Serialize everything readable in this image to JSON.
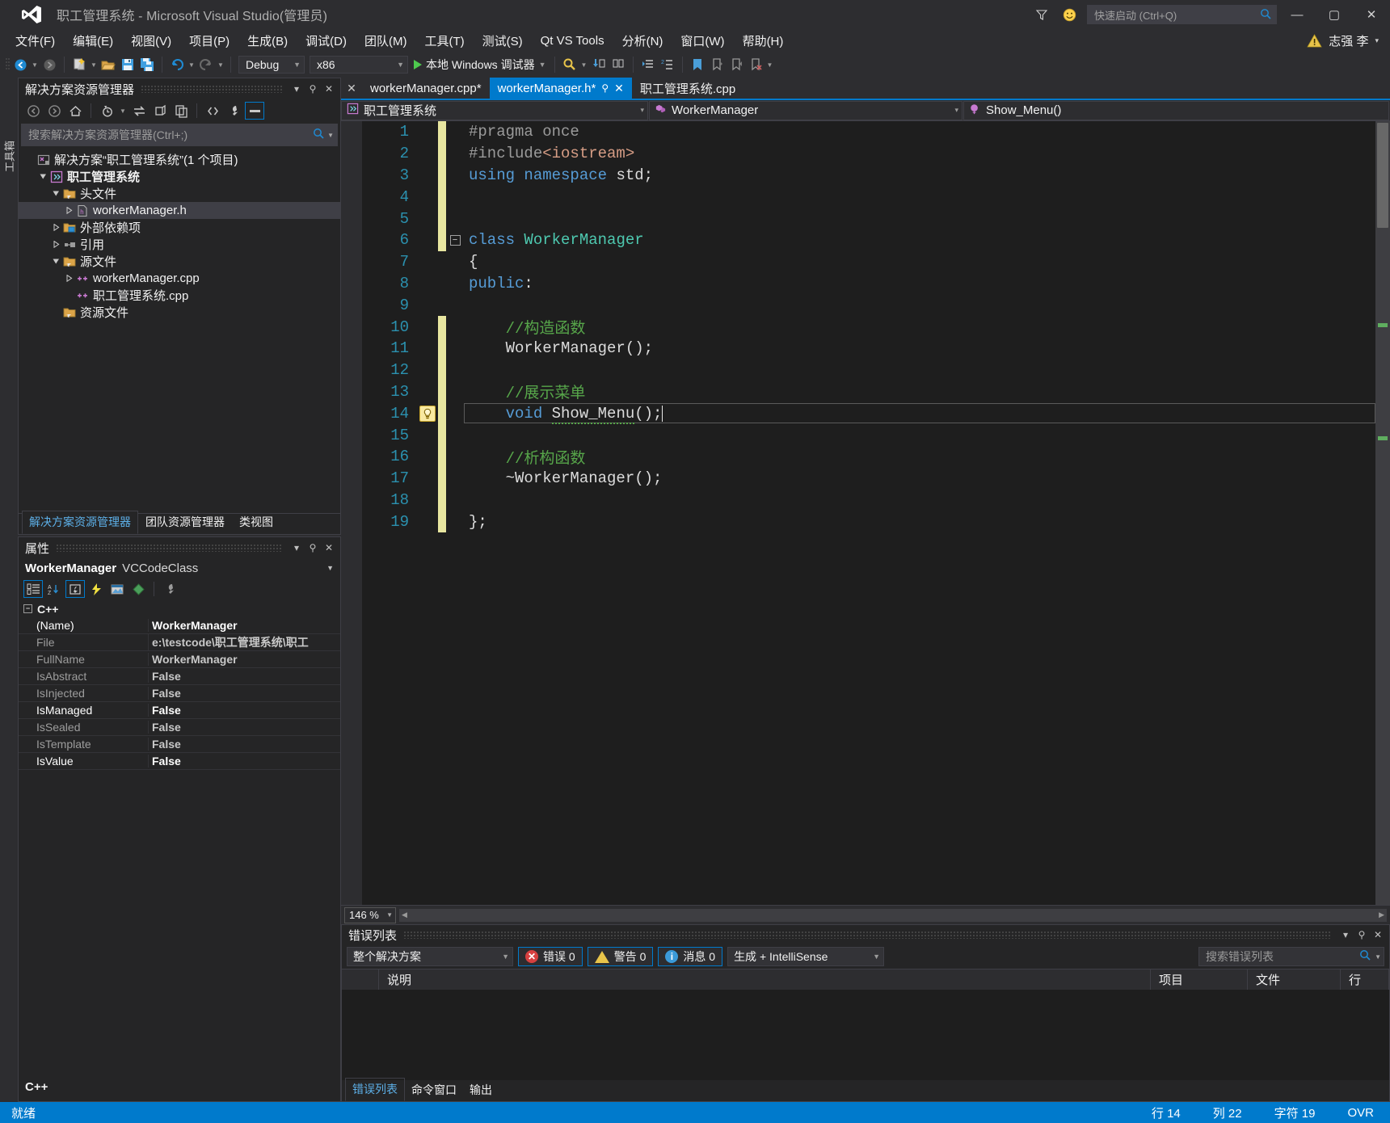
{
  "titlebar": {
    "title": "职工管理系统 - Microsoft Visual Studio(管理员)",
    "quick_launch_placeholder": "快速启动 (Ctrl+Q)",
    "minimize": "—",
    "maximize": "▢",
    "close": "✕",
    "feedback_icon": "smiley-icon",
    "filter_icon": "funnel-icon"
  },
  "menubar": {
    "items": [
      "文件(F)",
      "编辑(E)",
      "视图(V)",
      "项目(P)",
      "生成(B)",
      "调试(D)",
      "团队(M)",
      "工具(T)",
      "测试(S)",
      "Qt VS Tools",
      "分析(N)",
      "窗口(W)",
      "帮助(H)"
    ],
    "user": "志强 李",
    "user_caret": "▾"
  },
  "toolbar": {
    "nav_back": "◀",
    "nav_forward": "▶",
    "config": "Debug",
    "platform": "x86",
    "run_label": "本地 Windows 调试器",
    "caret": "▾"
  },
  "left_vertical_tab": "工具箱",
  "solution_explorer": {
    "title": "解决方案资源管理器",
    "pin": "⚲",
    "close": "✕",
    "caret": "▾",
    "search_placeholder": "搜索解决方案资源管理器(Ctrl+;)",
    "toolbar_icons": [
      "back-icon",
      "forward-icon",
      "home-icon",
      "pending-changes-icon",
      "sync-with-active-document-icon",
      "refresh-icon",
      "collapse-all-icon",
      "show-all-files-icon",
      "properties-icon",
      "preview-selected-items-icon"
    ],
    "tree": [
      {
        "label": "解决方案“职工管理系统”(1 个项目)",
        "indent": 0,
        "arrow": "none",
        "icon": "solution-icon",
        "selected": false,
        "bold": false
      },
      {
        "label": "职工管理系统",
        "indent": 1,
        "arrow": "open",
        "icon": "cpp-project-icon",
        "selected": false,
        "bold": true
      },
      {
        "label": "头文件",
        "indent": 2,
        "arrow": "open",
        "icon": "folder-filter-icon",
        "selected": false,
        "bold": false
      },
      {
        "label": "workerManager.h",
        "indent": 3,
        "arrow": "closed",
        "icon": "h-file-icon",
        "selected": true,
        "bold": false
      },
      {
        "label": "外部依赖项",
        "indent": 2,
        "arrow": "closed",
        "icon": "external-deps-icon",
        "selected": false,
        "bold": false
      },
      {
        "label": "引用",
        "indent": 2,
        "arrow": "closed",
        "icon": "references-icon",
        "selected": false,
        "bold": false
      },
      {
        "label": "源文件",
        "indent": 2,
        "arrow": "open",
        "icon": "folder-filter-icon",
        "selected": false,
        "bold": false
      },
      {
        "label": "workerManager.cpp",
        "indent": 3,
        "arrow": "closed",
        "icon": "cpp-file-icon",
        "selected": false,
        "bold": false
      },
      {
        "label": "职工管理系统.cpp",
        "indent": 3,
        "arrow": "none",
        "icon": "cpp-file-icon",
        "selected": false,
        "bold": false
      },
      {
        "label": "资源文件",
        "indent": 2,
        "arrow": "none",
        "icon": "folder-filter-icon",
        "selected": false,
        "bold": false
      }
    ],
    "tabs": [
      {
        "label": "解决方案资源管理器",
        "active": true
      },
      {
        "label": "团队资源管理器",
        "active": false
      },
      {
        "label": "类视图",
        "active": false
      }
    ]
  },
  "properties": {
    "title": "属性",
    "caret": "▾",
    "pin": "⚲",
    "close": "✕",
    "object_name": "WorkerManager",
    "object_type": "VCCodeClass",
    "toolbar_icons": [
      "categorized-icon",
      "alphabetical-icon",
      "properties-page-icon",
      "events-icon",
      "property-pages-icon",
      "messages-icon",
      "wrench-icon"
    ],
    "category": "C++",
    "rows": [
      {
        "key": "(Name)",
        "value": "WorkerManager",
        "highlight": true
      },
      {
        "key": "File",
        "value": "e:\\testcode\\职工管理系统\\职工",
        "highlight": false
      },
      {
        "key": "FullName",
        "value": "WorkerManager",
        "highlight": false
      },
      {
        "key": "IsAbstract",
        "value": "False",
        "highlight": false
      },
      {
        "key": "IsInjected",
        "value": "False",
        "highlight": false
      },
      {
        "key": "IsManaged",
        "value": "False",
        "highlight": true
      },
      {
        "key": "IsSealed",
        "value": "False",
        "highlight": false
      },
      {
        "key": "IsTemplate",
        "value": "False",
        "highlight": false
      },
      {
        "key": "IsValue",
        "value": "False",
        "highlight": true
      }
    ],
    "footer": "C++"
  },
  "editor": {
    "tabs": [
      {
        "label": "workerManager.cpp*",
        "active": false,
        "pinned": false,
        "closable": false
      },
      {
        "label": "workerManager.h*",
        "active": true,
        "pinned": true,
        "closable": true
      },
      {
        "label": "职工管理系统.cpp",
        "active": false,
        "pinned": false,
        "closable": false
      }
    ],
    "tab_close_left": "✕",
    "tab_pin_glyph": "⚲",
    "tab_close_glyph": "✕",
    "nav": {
      "project": "职工管理系统",
      "class": "WorkerManager",
      "member": "Show_Menu()",
      "arrow": "▾"
    },
    "zoom": "146 %",
    "lines": [
      {
        "n": 1,
        "changed": true,
        "fold": "none",
        "bulb": false,
        "current": false,
        "tokens": [
          {
            "t": "#pragma once",
            "c": "c-pre"
          }
        ]
      },
      {
        "n": 2,
        "changed": true,
        "fold": "none",
        "bulb": false,
        "current": false,
        "tokens": [
          {
            "t": "#include",
            "c": "c-pre"
          },
          {
            "t": "<iostream>",
            "c": "c-str"
          }
        ]
      },
      {
        "n": 3,
        "changed": true,
        "fold": "none",
        "bulb": false,
        "current": false,
        "tokens": [
          {
            "t": "using",
            "c": "c-kw"
          },
          {
            "t": " ",
            "c": "c-punc"
          },
          {
            "t": "namespace",
            "c": "c-kw"
          },
          {
            "t": " std;",
            "c": "c-id"
          }
        ]
      },
      {
        "n": 4,
        "changed": true,
        "fold": "none",
        "bulb": false,
        "current": false,
        "tokens": []
      },
      {
        "n": 5,
        "changed": true,
        "fold": "none",
        "bulb": false,
        "current": false,
        "tokens": []
      },
      {
        "n": 6,
        "changed": true,
        "fold": "start",
        "bulb": false,
        "current": false,
        "tokens": [
          {
            "t": "class",
            "c": "c-kw"
          },
          {
            "t": " ",
            "c": "c-punc"
          },
          {
            "t": "WorkerManager",
            "c": "c-type"
          }
        ]
      },
      {
        "n": 7,
        "changed": false,
        "fold": "line",
        "bulb": false,
        "current": false,
        "tokens": [
          {
            "t": "{",
            "c": "c-punc"
          }
        ]
      },
      {
        "n": 8,
        "changed": false,
        "fold": "line",
        "bulb": false,
        "current": false,
        "tokens": [
          {
            "t": "public",
            "c": "c-kw"
          },
          {
            "t": ":",
            "c": "c-punc"
          }
        ]
      },
      {
        "n": 9,
        "changed": false,
        "fold": "line",
        "bulb": false,
        "current": false,
        "tokens": []
      },
      {
        "n": 10,
        "changed": true,
        "fold": "line",
        "bulb": false,
        "current": false,
        "tokens": [
          {
            "t": "    //构造函数",
            "c": "c-cmt"
          }
        ]
      },
      {
        "n": 11,
        "changed": true,
        "fold": "line",
        "bulb": false,
        "current": false,
        "tokens": [
          {
            "t": "    WorkerManager();",
            "c": "c-id"
          }
        ]
      },
      {
        "n": 12,
        "changed": true,
        "fold": "line",
        "bulb": false,
        "current": false,
        "tokens": []
      },
      {
        "n": 13,
        "changed": true,
        "fold": "line",
        "bulb": false,
        "current": false,
        "tokens": [
          {
            "t": "    //展示菜单",
            "c": "c-cmt"
          }
        ]
      },
      {
        "n": 14,
        "changed": true,
        "fold": "line",
        "bulb": true,
        "current": true,
        "tokens": [
          {
            "t": "    ",
            "c": "c-punc"
          },
          {
            "t": "void",
            "c": "c-kw"
          },
          {
            "t": " ",
            "c": "c-punc"
          },
          {
            "t": "Show_Menu",
            "c": "c-fn",
            "squiggle": true
          },
          {
            "t": "();",
            "c": "c-punc"
          }
        ]
      },
      {
        "n": 15,
        "changed": true,
        "fold": "line",
        "bulb": false,
        "current": false,
        "tokens": []
      },
      {
        "n": 16,
        "changed": true,
        "fold": "line",
        "bulb": false,
        "current": false,
        "tokens": [
          {
            "t": "    //析构函数",
            "c": "c-cmt"
          }
        ]
      },
      {
        "n": 17,
        "changed": true,
        "fold": "line",
        "bulb": false,
        "current": false,
        "tokens": [
          {
            "t": "    ~WorkerManager();",
            "c": "c-id"
          }
        ]
      },
      {
        "n": 18,
        "changed": true,
        "fold": "line",
        "bulb": false,
        "current": false,
        "tokens": []
      },
      {
        "n": 19,
        "changed": true,
        "fold": "end",
        "bulb": false,
        "current": false,
        "tokens": [
          {
            "t": "};",
            "c": "c-punc"
          }
        ]
      }
    ]
  },
  "error_list": {
    "title": "错误列表",
    "caret": "▾",
    "pin": "⚲",
    "close": "✕",
    "scope": "整个解决方案",
    "errors_label": "错误 0",
    "warnings_label": "警告 0",
    "messages_label": "消息 0",
    "source_filter": "生成 + IntelliSense",
    "search_placeholder": "搜索错误列表",
    "columns": [
      "",
      "说明",
      "项目",
      "文件",
      "行"
    ],
    "tabs": [
      {
        "label": "错误列表",
        "active": true
      },
      {
        "label": "命令窗口",
        "active": false
      },
      {
        "label": "输出",
        "active": false
      }
    ]
  },
  "statusbar": {
    "ready": "就绪",
    "line": "行 14",
    "col": "列 22",
    "char": "字符 19",
    "mode": "OVR"
  },
  "colors": {
    "accent": "#007acc",
    "chrome": "#2d2d30",
    "panel": "#252526",
    "editor_bg": "#1e1e1e",
    "comment": "#57a64a",
    "keyword": "#569cd6",
    "type": "#4ec9b0",
    "string": "#d69d85",
    "linenum": "#2b91af",
    "changebar": "#e8e6a0"
  }
}
